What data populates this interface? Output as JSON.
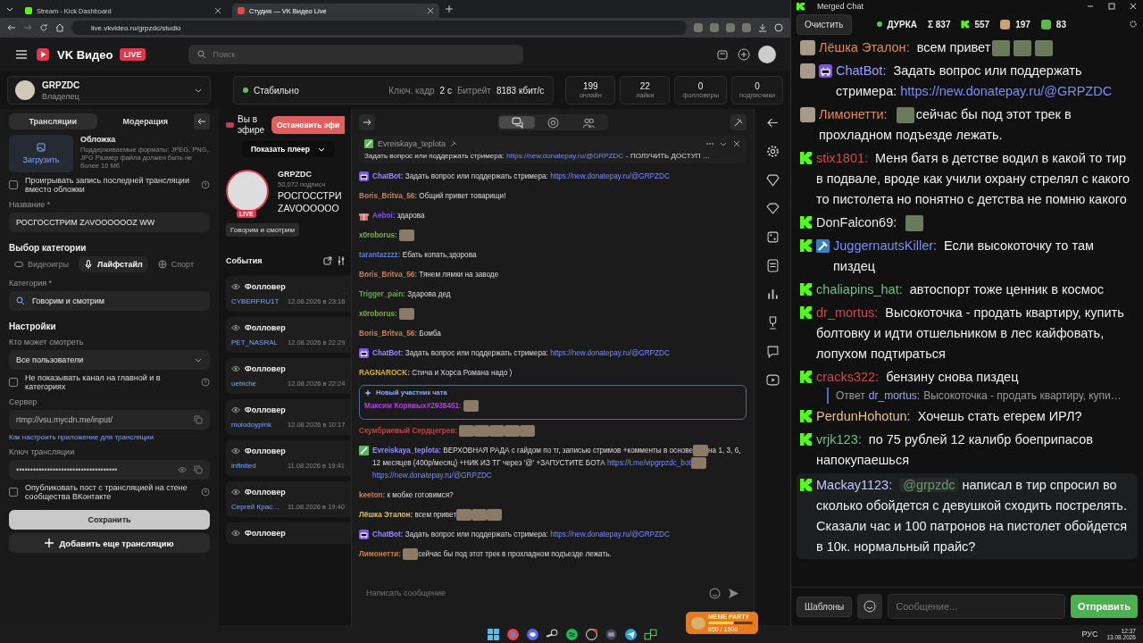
{
  "browser": {
    "tabs": [
      {
        "kind": "kick",
        "label": "Stream - Kick Dashboard",
        "selected": false
      },
      {
        "kind": "vk",
        "label": "Студия — VK Видео Live",
        "selected": true
      }
    ],
    "url": "live.vkvideo.ru/grpzdc/studio"
  },
  "header": {
    "logo_text": "VK Видео",
    "live_badge": "LIVE",
    "search_placeholder": "Поиск"
  },
  "channel": {
    "name": "GRPZDC",
    "role": "Владелец"
  },
  "stream_status": {
    "status": "Стабильно",
    "keyframe_label": "Ключ. кадр",
    "keyframe": "2 с",
    "bitrate_label": "Битрейт",
    "bitrate": "8183 кбит/с"
  },
  "stats": [
    {
      "value": "199",
      "label": "онлайн"
    },
    {
      "value": "22",
      "label": "лайки"
    },
    {
      "value": "0",
      "label": "фолловеры"
    },
    {
      "value": "0",
      "label": "подписчики"
    }
  ],
  "settings_panel": {
    "tabs": [
      {
        "label": "Трансляции",
        "selected": true
      },
      {
        "label": "Модерация",
        "selected": false
      }
    ],
    "cover": {
      "upload": "Загрузить",
      "title": "Обложка",
      "hint": "Поддерживаемые форматы: JPEG, PNG, JPG Размер файла должен быть не более 10 Мб"
    },
    "replay_checkbox": {
      "label": "Проигрывать запись последней трансляции вместо обложки",
      "checked": false
    },
    "title_label": "Название *",
    "title_value": "РОСГОССТРИМ ZAVOOOOOOZ WW",
    "category_heading": "Выбор категории",
    "category_types": [
      {
        "kind": "games",
        "label": "Видеоигры",
        "selected": false
      },
      {
        "kind": "lifestyle",
        "label": "Лайфстайл",
        "selected": true
      },
      {
        "kind": "sport",
        "label": "Спорт",
        "selected": false
      }
    ],
    "category_label": "Категория *",
    "category_value": "Говорим и смотрим",
    "settings_heading": "Настройки",
    "audience_label": "Кто может смотреть",
    "audience_value": "Все пользователи",
    "hide_checkbox": {
      "label": "Не показывать канал на главной и в категориях",
      "checked": false
    },
    "server_label": "Сервер",
    "server_value": "rtmp://vsu.mycdn.me/input/",
    "setup_link": "Как настроить приложение для трансляции",
    "key_label": "Ключ трансляции",
    "key_value": "••••••••••••••••••••••••••••••••••••",
    "publish_checkbox": {
      "label": "Опубликовать пост с трансляцией на стене сообщества ВКонтакте",
      "checked": false
    },
    "save_button": "Сохранить",
    "add_button": "Добавить еще трансляцию"
  },
  "live": {
    "on_air": "Вы в эфире",
    "stop_button": "Остановить эфи",
    "show_player": "Показать плеер",
    "avatar_badge": "LIVE",
    "streamer": "GRPZDC",
    "subscribers": "50,072 подписч",
    "stream_title_lines": [
      "РОСГОССТРИ",
      "ZAVOOOOOO"
    ],
    "category_tag": "Говорим и смотрим",
    "events_title": "События",
    "events": [
      {
        "type": "Фолловер",
        "user": "CYBERFRU1T",
        "time": "12.08.2026 в 23:16"
      },
      {
        "type": "Фолловер",
        "user": "PET_NASRAL",
        "time": "12.08.2026 в 22:29"
      },
      {
        "type": "Фолловер",
        "user": "uebiche",
        "time": "12.08.2026 в 22:24"
      },
      {
        "type": "Фолловер",
        "user": "molodoypink",
        "time": "12.08.2026 в 10:17"
      },
      {
        "type": "Фолловер",
        "user": "infinited",
        "time": "11.08.2026 в 19:41"
      },
      {
        "type": "Фолловер",
        "user": "Сергей Крас…",
        "time": "11.08.2026 в 19:40"
      },
      {
        "type": "Фолловер"
      }
    ]
  },
  "chat": {
    "tabs": [
      {
        "kind": "chat",
        "selected": true
      },
      {
        "kind": "mentions",
        "selected": false
      },
      {
        "kind": "users",
        "selected": false
      }
    ],
    "pinned": {
      "author": "Evreiskaya_teplota",
      "text": "Задать вопрос или поддержать стримера:",
      "link": "https://new.donatepay.ru/@GRPZDC",
      "rest": "- ПОЛУЧИТЬ ДОСТУП …"
    },
    "messages": [
      {
        "kind": "message",
        "badge": {
          "kind": "bot"
        },
        "author": "ChatBot:",
        "color": "#9b8cff",
        "parts": [
          {
            "kind": "text",
            "text": "Задать вопрос или поддержать стримера:"
          },
          {
            "kind": "link",
            "text": "https://new.donatepay.ru/@GRPZDC"
          }
        ]
      },
      {
        "kind": "message",
        "author": "Boris_Britva_56:",
        "color": "#c8825a",
        "parts": [
          {
            "kind": "text",
            "text": "Общий привет товарищи!"
          }
        ]
      },
      {
        "kind": "message",
        "badge": {
          "kind": "gift"
        },
        "author": "Aeboi:",
        "color": "#8a4fff",
        "parts": [
          {
            "kind": "text",
            "text": "здарова"
          }
        ]
      },
      {
        "kind": "message",
        "author": "x0roborus:",
        "color": "#7fae4f",
        "parts": [
          {
            "kind": "emote"
          }
        ]
      },
      {
        "kind": "message",
        "author": "tarantazzzz:",
        "color": "#5a7ed8",
        "parts": [
          {
            "kind": "text",
            "text": "Ебать копать,здорова"
          }
        ]
      },
      {
        "kind": "message",
        "author": "Boris_Britva_56:",
        "color": "#c8825a",
        "parts": [
          {
            "kind": "text",
            "text": "Тянем лямки на заводе"
          }
        ]
      },
      {
        "kind": "message",
        "author": "Trigger_pain:",
        "color": "#6aa84f",
        "parts": [
          {
            "kind": "text",
            "text": "Здарова дед"
          }
        ]
      },
      {
        "kind": "message",
        "author": "x0roborus:",
        "color": "#7fae4f",
        "parts": [
          {
            "kind": "emote"
          }
        ]
      },
      {
        "kind": "message",
        "author": "Boris_Britva_56:",
        "color": "#c8825a",
        "parts": [
          {
            "kind": "text",
            "text": "Бомба"
          }
        ]
      },
      {
        "kind": "message",
        "badge": {
          "kind": "bot"
        },
        "author": "ChatBot:",
        "color": "#9b8cff",
        "parts": [
          {
            "kind": "text",
            "text": "Задать вопрос или поддержать стримера:"
          },
          {
            "kind": "link",
            "text": "https://new.donatepay.ru/@GRPZDC"
          }
        ]
      },
      {
        "kind": "message",
        "author": "RAGNAROCK:",
        "color": "#e0b030",
        "parts": [
          {
            "kind": "text",
            "text": "Стича и Хорса Романа надо )"
          }
        ]
      },
      {
        "kind": "new_member",
        "header": "Новый участник чата",
        "author": "Максим Корявых#2938451:",
        "color": "#b040e0",
        "parts": [
          {
            "kind": "emote"
          }
        ]
      },
      {
        "kind": "message",
        "author": "Скумбриевый Сердцегрев:",
        "color": "#c84040",
        "parts": [
          {
            "kind": "emote"
          },
          {
            "kind": "emote"
          },
          {
            "kind": "emote"
          },
          {
            "kind": "emote"
          },
          {
            "kind": "emote"
          }
        ]
      },
      {
        "kind": "message",
        "badge": {
          "kind": "pen"
        },
        "author": "Evreiskaya_teplota:",
        "color": "#8f8fff",
        "parts": [
          {
            "kind": "text",
            "text": "ВЕРХОВНАЯ РАДА с гайдом по тг, записью стримов +комменты в основе"
          },
          {
            "kind": "emote"
          },
          {
            "kind": "text",
            "text": "на 1, 3, 6, 12 месяцев (400р/месяц) +НИК ИЗ ТГ через '@' +ЗАПУСТИТЕ БОТА"
          },
          {
            "kind": "link",
            "text": "https://t.me/vipgrpzdc_bot"
          },
          {
            "kind": "emote"
          },
          {
            "kind": "link",
            "text": "https://new.donatepay.ru/@GRPZDC"
          }
        ]
      },
      {
        "kind": "message",
        "author": "keeton:",
        "color": "#d08050",
        "parts": [
          {
            "kind": "text",
            "text": "к мобке готовимся?"
          }
        ]
      },
      {
        "kind": "message",
        "author": "Лёшка Эталон:",
        "color": "#e0c060",
        "parts": [
          {
            "kind": "text",
            "text": "всем привет"
          },
          {
            "kind": "emote"
          },
          {
            "kind": "emote"
          },
          {
            "kind": "emote"
          }
        ]
      },
      {
        "kind": "message",
        "badge": {
          "kind": "bot"
        },
        "author": "ChatBot:",
        "color": "#9b8cff",
        "parts": [
          {
            "kind": "text",
            "text": "Задать вопрос или поддержать стримера:"
          },
          {
            "kind": "link",
            "text": "https://new.donatepay.ru/@GRPZDC"
          }
        ]
      },
      {
        "kind": "message",
        "author": "Лимонетти:",
        "color": "#d08040",
        "parts": [
          {
            "kind": "emote"
          },
          {
            "kind": "text",
            "text": "сейчас бы под этот трек в прохладном подъезде лежать."
          }
        ]
      }
    ],
    "input_placeholder": "Написать сообщение"
  },
  "merged_chat": {
    "title": "Merged Chat",
    "clear_button": "Очистить",
    "channel": "ДУРКА",
    "counters": [
      {
        "kind": "total",
        "symbol": "Σ",
        "value": "837"
      },
      {
        "kind": "kick",
        "value": "557"
      },
      {
        "kind": "vk",
        "value": "197"
      },
      {
        "kind": "other",
        "value": "83"
      }
    ],
    "messages": [
      {
        "kind": "vk",
        "highlighted": false,
        "author": "Лёшка Эталон:",
        "color": "#e08a50",
        "parts": [
          {
            "kind": "text",
            "text": "всем привет"
          },
          {
            "kind": "emote"
          },
          {
            "kind": "emote"
          },
          {
            "kind": "emote"
          }
        ]
      },
      {
        "kind": "vk",
        "highlighted": false,
        "badge": {
          "kind": "bot"
        },
        "author": "ChatBot:",
        "color": "#9aa0ff",
        "parts": [
          {
            "kind": "text",
            "text": "Задать вопрос или поддержать стримера:"
          },
          {
            "kind": "link",
            "text": "https://new.donatepay.ru/@GRPZDC"
          }
        ]
      },
      {
        "kind": "vk",
        "highlighted": false,
        "author": "Лимонетти:",
        "color": "#e08a50",
        "parts": [
          {
            "kind": "emote"
          },
          {
            "kind": "text",
            "text": "сейчас бы под этот трек в прохладном подъезде лежать."
          }
        ]
      },
      {
        "kind": "kick",
        "highlighted": false,
        "author": "stix1801:",
        "color": "#d04848",
        "parts": [
          {
            "kind": "text",
            "text": "Меня батя в детстве водил в какой то тир в подвале, вроде как учили охрану стрелял с какого то пистолета но понятно с детства не помню какого"
          }
        ]
      },
      {
        "kind": "kick",
        "highlighted": false,
        "author": "DonFalcon69:",
        "color": "#e6e6e6",
        "parts": [
          {
            "kind": "emote"
          }
        ]
      },
      {
        "kind": "kick",
        "highlighted": false,
        "badge": {
          "kind": "hammer"
        },
        "author": "JuggernautsKiller:",
        "color": "#7a8cff",
        "parts": [
          {
            "kind": "text",
            "text": "Если высокоточку то там пиздец"
          }
        ]
      },
      {
        "kind": "kick",
        "highlighted": false,
        "author": "chaliapins_hat:",
        "color": "#6ac08a",
        "parts": [
          {
            "kind": "text",
            "text": "автоспорт тоже ценник в космос"
          }
        ]
      },
      {
        "kind": "kick",
        "highlighted": false,
        "author": "dr_mortus:",
        "color": "#d04848",
        "parts": [
          {
            "kind": "text",
            "text": "Высокоточка - продать квартиру, купить болтовку и идти отшельником в лес кайфовать, лопухом подтираться"
          }
        ]
      },
      {
        "kind": "kick",
        "highlighted": false,
        "author": "cracks322:",
        "color": "#d04848",
        "parts": [
          {
            "kind": "text",
            "text": "бензину снова пиздец"
          }
        ],
        "reply": {
          "label": "Ответ",
          "author": "dr_mortus:",
          "text": "Высокоточка - продать квартиру, купи…"
        }
      },
      {
        "kind": "kick",
        "highlighted": false,
        "author": "PerdunHohotun:",
        "color": "#e8c080",
        "parts": [
          {
            "kind": "text",
            "text": "Хочешь стать егерем ИРЛ?"
          }
        ]
      },
      {
        "kind": "kick",
        "highlighted": false,
        "author": "vrjk123:",
        "color": "#6ac08a",
        "parts": [
          {
            "kind": "text",
            "text": "по 75 рублей 12 калибр боеприпасов напокупаешься"
          }
        ]
      },
      {
        "kind": "kick",
        "highlighted": true,
        "author": "Mackay1123:",
        "color": "#c0c8ff",
        "parts": [
          {
            "kind": "mention",
            "text": "@grpzdc"
          },
          {
            "kind": "text",
            "text": "написал в тир спросил во сколько обойдется с девушкой сходить пострелять. Сказали час и 100 патронов на пистолет обойдется в 10к. нормальный прайс?"
          }
        ]
      }
    ],
    "templates_button": "Шаблоны",
    "input_placeholder": "Сообщение...",
    "send_button": "Отправить"
  },
  "overlay": {
    "title": "MEME PARTY",
    "progress": "850 / 1500",
    "level": 0.57
  },
  "taskbar": {
    "language": "РУС",
    "time": "12:37",
    "date": "13.08.2026"
  }
}
